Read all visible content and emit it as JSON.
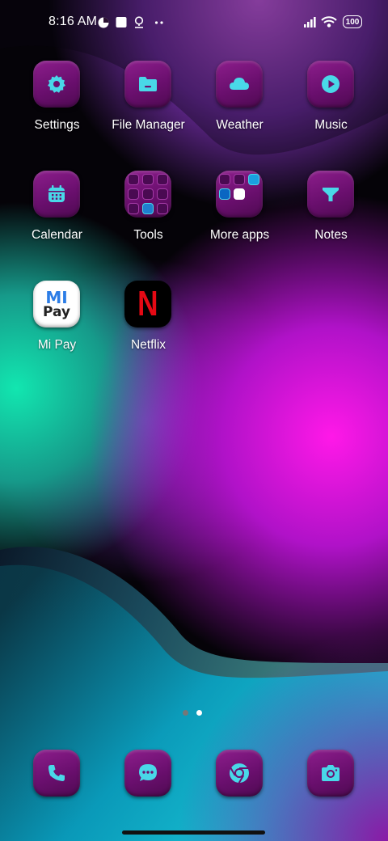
{
  "status_bar": {
    "time": "8:16 AM",
    "battery": "100"
  },
  "home": {
    "apps": [
      {
        "label": "Settings",
        "icon": "gear-icon"
      },
      {
        "label": "File Manager",
        "icon": "folder-icon"
      },
      {
        "label": "Weather",
        "icon": "cloud-icon"
      },
      {
        "label": "Music",
        "icon": "play-icon"
      },
      {
        "label": "Calendar",
        "icon": "calendar-icon"
      },
      {
        "label": "Tools",
        "icon": "folder-grid-icon"
      },
      {
        "label": "More apps",
        "icon": "folder-grid-icon"
      },
      {
        "label": "Notes",
        "icon": "funnel-icon"
      },
      {
        "label": "Mi Pay",
        "icon": "mi-pay-logo",
        "logo_text_top": "MI",
        "logo_text_bottom": "Pay"
      },
      {
        "label": "Netflix",
        "icon": "netflix-logo",
        "logo_text": "N"
      }
    ],
    "page_indicator": {
      "pages": 2,
      "active": 2
    }
  },
  "dock": [
    {
      "name": "phone",
      "icon": "phone-icon"
    },
    {
      "name": "messages",
      "icon": "chat-bubble-icon"
    },
    {
      "name": "chrome",
      "icon": "chrome-icon"
    },
    {
      "name": "camera",
      "icon": "camera-icon"
    }
  ],
  "colors": {
    "icon_bg": "#7a1479",
    "glyph": "#49d8e8",
    "netflix_red": "#e50914",
    "mipay_blue": "#2c7de6"
  }
}
